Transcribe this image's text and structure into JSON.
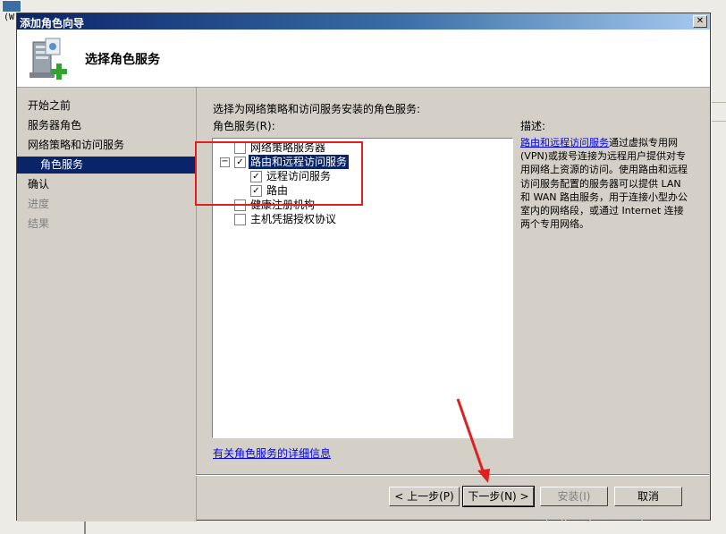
{
  "background": {
    "left_label": "(W"
  },
  "window": {
    "title": "添加角色向导",
    "close_glyph": "✕"
  },
  "header": {
    "title": "选择角色服务"
  },
  "nav": {
    "items": [
      {
        "label": "开始之前",
        "state": "normal"
      },
      {
        "label": "服务器角色",
        "state": "normal"
      },
      {
        "label": "网络策略和访问服务",
        "state": "normal"
      },
      {
        "label": "角色服务",
        "state": "selected"
      },
      {
        "label": "确认",
        "state": "normal"
      },
      {
        "label": "进度",
        "state": "disabled"
      },
      {
        "label": "结果",
        "state": "disabled"
      }
    ]
  },
  "content": {
    "instruction": "选择为网络策略和访问服务安装的角色服务:",
    "list_label": "角色服务(R):",
    "tree": [
      {
        "label": "网络策略服务器",
        "checked": false,
        "expander": "",
        "selected": false
      },
      {
        "label": "路由和远程访问服务",
        "checked": true,
        "expander": "−",
        "selected": true
      },
      {
        "label": "远程访问服务",
        "checked": true,
        "expander": "",
        "selected": false
      },
      {
        "label": "路由",
        "checked": true,
        "expander": "",
        "selected": false
      },
      {
        "label": "健康注册机构",
        "checked": false,
        "expander": "",
        "selected": false
      },
      {
        "label": "主机凭据授权协议",
        "checked": false,
        "expander": "",
        "selected": false
      }
    ],
    "check_glyph": "✓",
    "description_label": "描述:",
    "description_link": "路由和远程访问服务",
    "description_text": "通过虚拟专用网(VPN)或拨号连接为远程用户提供对专用网络上资源的访问。使用路由和远程访问服务配置的服务器可以提供 LAN 和 WAN 路由服务，用于连接小型办公室内的网络段，或通过 Internet 连接两个专用网络。",
    "more_info_link": "有关角色服务的详细信息"
  },
  "buttons": {
    "back": "< 上一步(P)",
    "next": "下一步(N) >",
    "install": "安装(I)",
    "cancel": "取消"
  },
  "annotations": {
    "highlight_color": "#e02020"
  },
  "watermark": "https://blog.csdn.net/cbcrzcbc"
}
